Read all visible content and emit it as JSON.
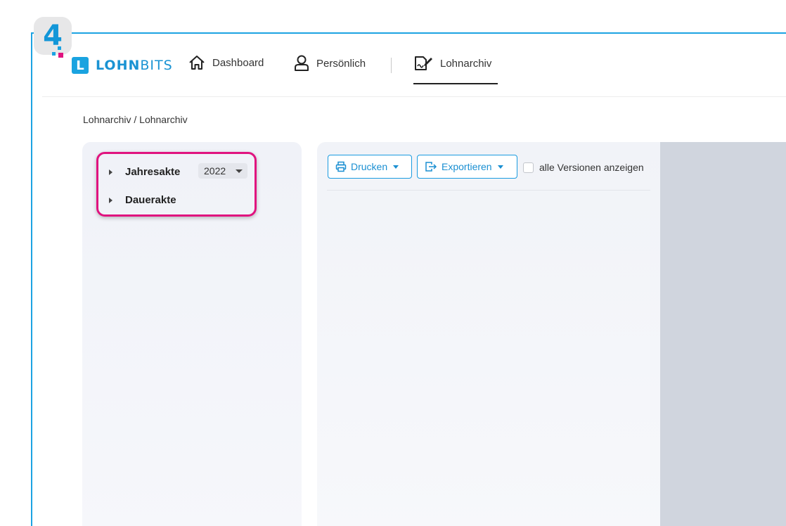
{
  "step_badge": "4",
  "logo": {
    "letter": "L",
    "text_bold": "LOHN",
    "text_light": "BITS"
  },
  "nav": {
    "dashboard": "Dashboard",
    "persoenlich": "Persönlich",
    "lohnarchiv": "Lohnarchiv"
  },
  "breadcrumb": "Lohnarchiv / Lohnarchiv",
  "tree": {
    "jahresakte": "Jahresakte",
    "year": "2022",
    "dauerakte": "Dauerakte"
  },
  "toolbar": {
    "drucken": "Drucken",
    "exportieren": "Exportieren",
    "versionen": "alle Versionen anzeigen"
  },
  "colors": {
    "brand_blue": "#1aa3e0",
    "highlight_magenta": "#e0137f",
    "preview_gray": "#d0d5de"
  },
  "icons": [
    "home-icon",
    "user-icon",
    "archive-signature-icon",
    "printer-icon",
    "export-icon"
  ]
}
